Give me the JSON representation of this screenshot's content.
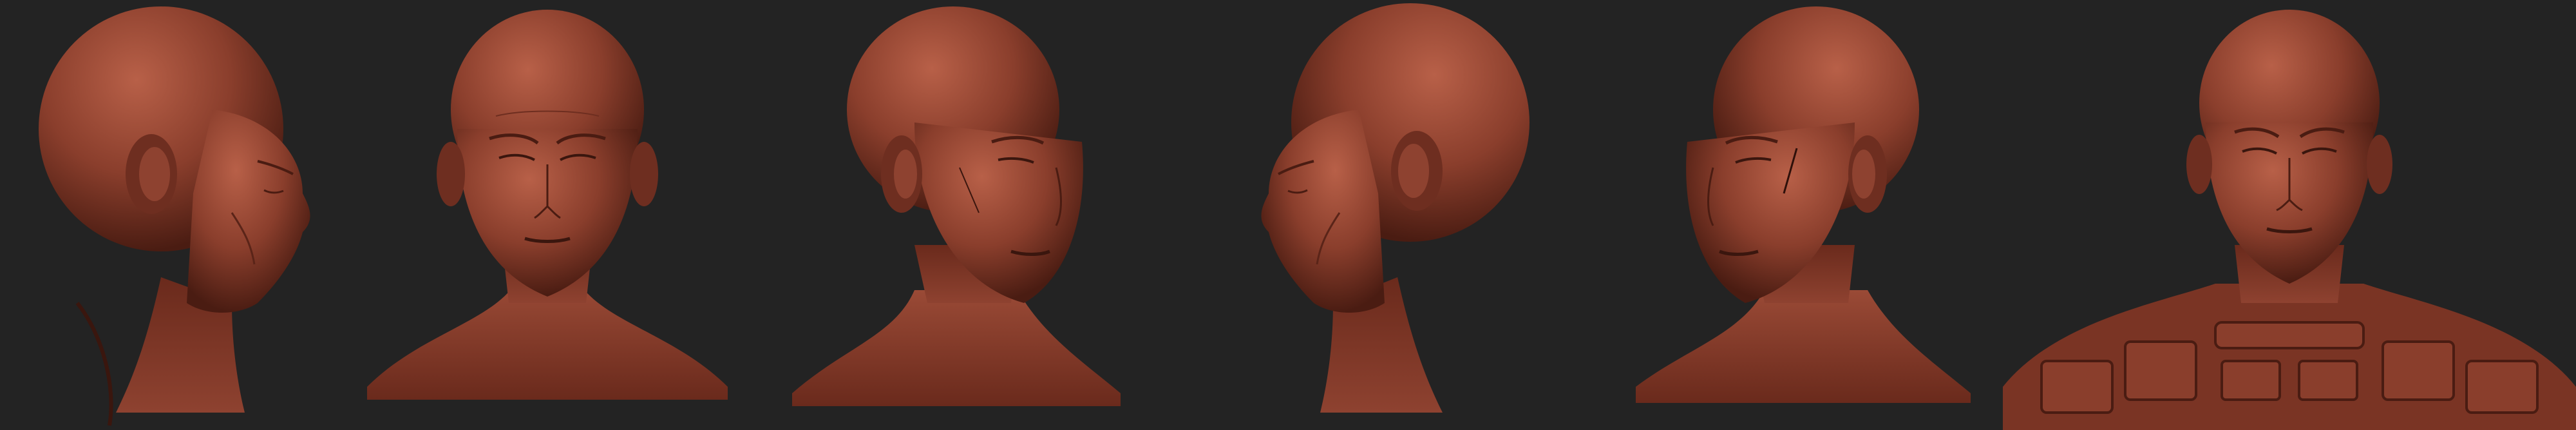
{
  "background_color": "#232323",
  "clay_color": "#8a3e2c",
  "clay_highlight": "#b45a42",
  "clay_shadow": "#4a1c12",
  "views": [
    {
      "name": "left-profile-view",
      "angle": "profile-right-facing"
    },
    {
      "name": "front-view",
      "angle": "front"
    },
    {
      "name": "three-quarter-right-view",
      "angle": "three-quarter"
    },
    {
      "name": "right-profile-view",
      "angle": "profile-left-facing"
    },
    {
      "name": "three-quarter-left-view",
      "angle": "three-quarter"
    },
    {
      "name": "front-armored-view",
      "angle": "front-with-torso"
    }
  ]
}
